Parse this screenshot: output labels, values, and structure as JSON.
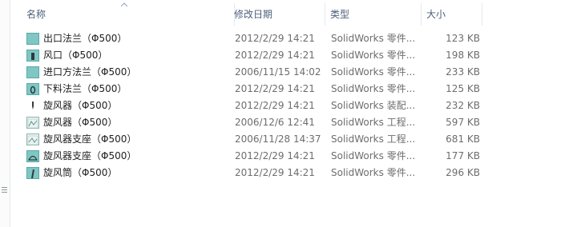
{
  "columns": {
    "name": "名称",
    "date": "修改日期",
    "type": "类型",
    "size": "大小"
  },
  "files": [
    {
      "name": "出口法兰（Φ500）",
      "date": "2012/2/29 14:21",
      "type": "SolidWorks 零件...",
      "size": "123 KB",
      "icon": "solidworks-part-icon"
    },
    {
      "name": "风口（Φ500）",
      "date": "2012/2/29 14:21",
      "type": "SolidWorks 零件...",
      "size": "198 KB",
      "icon": "solidworks-part-icon"
    },
    {
      "name": "进口方法兰（Φ500）",
      "date": "2006/11/15 14:02",
      "type": "SolidWorks 零件...",
      "size": "233 KB",
      "icon": "solidworks-part-icon"
    },
    {
      "name": "下料法兰（Φ500）",
      "date": "2012/2/29 14:21",
      "type": "SolidWorks 零件...",
      "size": "125 KB",
      "icon": "solidworks-part-icon"
    },
    {
      "name": "旋风器（Φ500）",
      "date": "2012/2/29 14:21",
      "type": "SolidWorks 装配...",
      "size": "232 KB",
      "icon": "solidworks-assembly-icon"
    },
    {
      "name": "旋风器（Φ500）",
      "date": "2006/12/6 12:41",
      "type": "SolidWorks 工程...",
      "size": "597 KB",
      "icon": "solidworks-drawing-icon"
    },
    {
      "name": "旋风器支座（Φ500）",
      "date": "2006/11/28 14:37",
      "type": "SolidWorks 工程...",
      "size": "681 KB",
      "icon": "solidworks-drawing-icon"
    },
    {
      "name": "旋风器支座（Φ500）",
      "date": "2012/2/29 14:21",
      "type": "SolidWorks 零件...",
      "size": "177 KB",
      "icon": "solidworks-part-icon"
    },
    {
      "name": "旋风筒（Φ500）",
      "date": "2012/2/29 14:21",
      "type": "SolidWorks 零件...",
      "size": "296 KB",
      "icon": "solidworks-part-icon"
    }
  ],
  "colors": {
    "header_text": "#4c607a",
    "secondary_text": "#6d6d6d",
    "part_icon": "#7fc7c5"
  }
}
